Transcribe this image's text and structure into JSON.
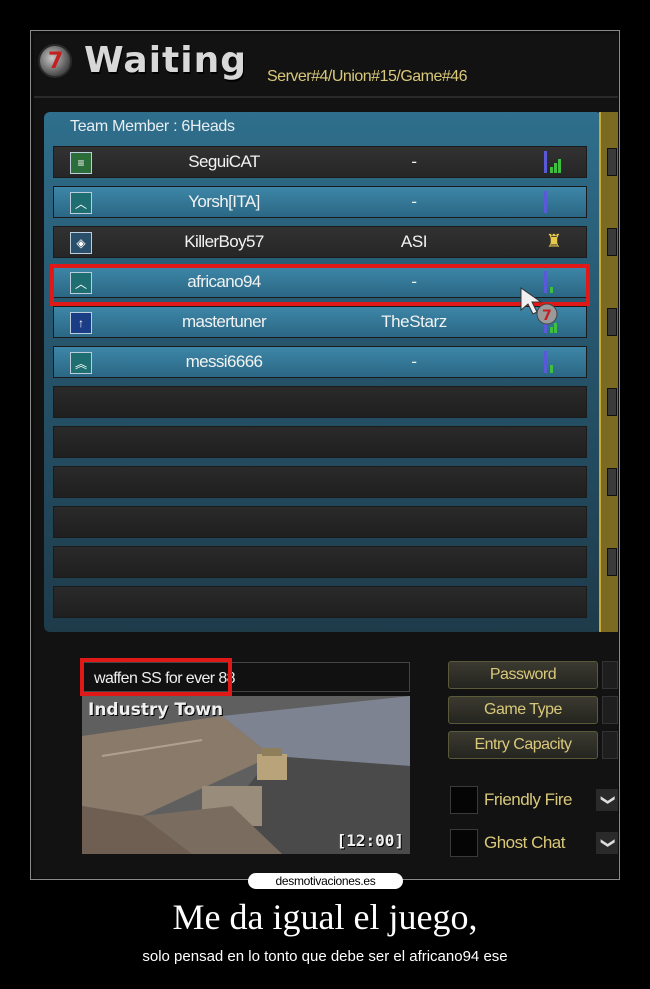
{
  "header": {
    "logo_glyph": "7",
    "title": "Waiting",
    "server": "Server#4/Union#15/Game#46"
  },
  "team": {
    "label": "Team Member : 6Heads",
    "players": [
      {
        "name": "SeguiCAT",
        "clan": "-",
        "rank_icon": "rank-bars-icon",
        "status_icon": "signal-icon"
      },
      {
        "name": "Yorsh[ITA]",
        "clan": "-",
        "rank_icon": "rank-chevron-icon",
        "status_icon": "signal-icon"
      },
      {
        "name": "KillerBoy57",
        "clan": "ASI",
        "rank_icon": "rank-wing-icon",
        "status_icon": "host-icon"
      },
      {
        "name": "africano94",
        "clan": "-",
        "rank_icon": "rank-chevron-icon",
        "status_icon": "signal-icon"
      },
      {
        "name": "mastertuner",
        "clan": "TheStarz",
        "rank_icon": "rank-arrow-icon",
        "status_icon": "signal-icon"
      },
      {
        "name": "messi6666",
        "clan": "-",
        "rank_icon": "rank-double-chevron-icon",
        "status_icon": "signal-icon"
      }
    ]
  },
  "room": {
    "chat_text": "waffen SS for ever 88",
    "map_name": "Industry Town",
    "time": "[12:00]"
  },
  "options": {
    "password": "Password",
    "game_type": "Game Type",
    "entry_capacity": "Entry Capacity",
    "friendly_fire": "Friendly Fire",
    "ghost_chat": "Ghost Chat"
  },
  "poster": {
    "watermark": "desmotivaciones.es",
    "caption": "Me da igual el juego,",
    "subcaption": "solo pensad en lo tonto que debe ser el africano94 ese"
  },
  "colors": {
    "highlight": "#e01818",
    "panel_blue": "#2f6f8c",
    "option_text": "#d9c87a"
  }
}
